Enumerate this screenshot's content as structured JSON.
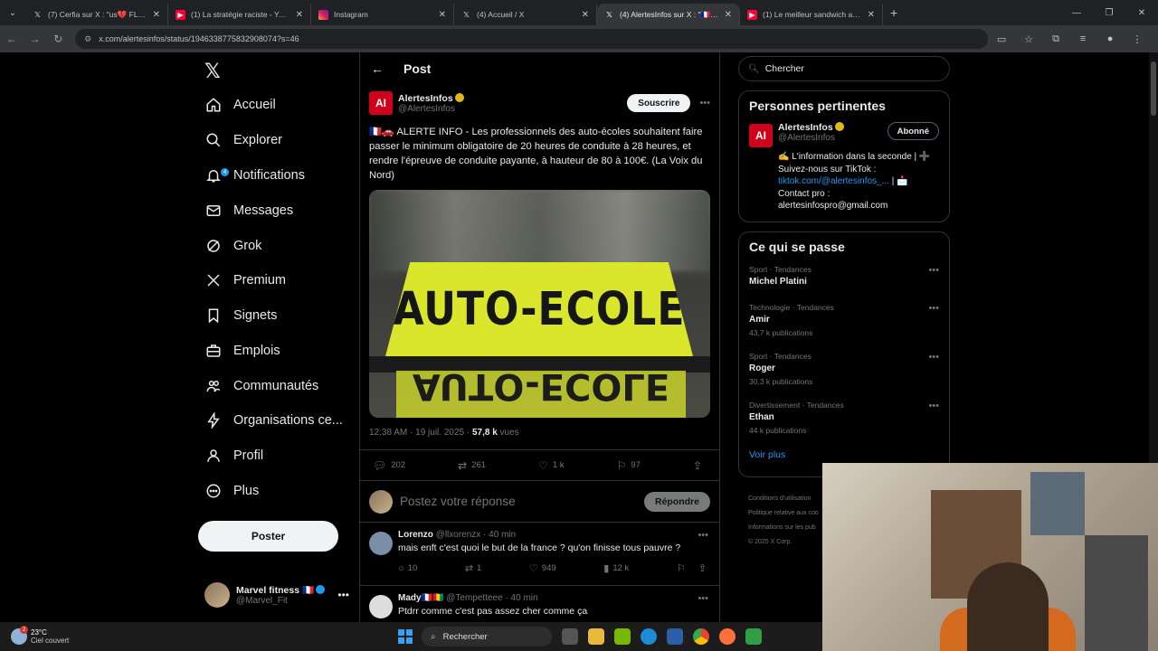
{
  "browser": {
    "tabs": [
      {
        "label": "(7) Cerfia sur X : \"us💔 FLASH |",
        "icon": "x-icon",
        "active": false
      },
      {
        "label": "(1) La stratégie raciste - YouTube",
        "icon": "youtube-icon",
        "active": false
      },
      {
        "label": "Instagram",
        "icon": "instagram-icon",
        "active": false
      },
      {
        "label": "(4) Accueil / X",
        "icon": "x-icon",
        "active": false
      },
      {
        "label": "(4) AlertesInfos sur X : \"🇫🇷🚗 AL",
        "icon": "x-icon",
        "active": true
      },
      {
        "label": "(1) Le meilleur sandwich au mo",
        "icon": "youtube-icon",
        "active": false
      }
    ],
    "url": "x.com/alertesinfos/status/1946338775832908074?s=46"
  },
  "sidebar": {
    "items": [
      {
        "label": "Accueil",
        "icon": "home-icon"
      },
      {
        "label": "Explorer",
        "icon": "search-icon"
      },
      {
        "label": "Notifications",
        "icon": "bell-icon",
        "badge": "4"
      },
      {
        "label": "Messages",
        "icon": "mail-icon"
      },
      {
        "label": "Grok",
        "icon": "grok-icon"
      },
      {
        "label": "Premium",
        "icon": "x-icon"
      },
      {
        "label": "Signets",
        "icon": "bookmark-icon"
      },
      {
        "label": "Emplois",
        "icon": "briefcase-icon"
      },
      {
        "label": "Communautés",
        "icon": "people-icon"
      },
      {
        "label": "Organisations ce...",
        "icon": "lightning-icon"
      },
      {
        "label": "Profil",
        "icon": "person-icon"
      },
      {
        "label": "Plus",
        "icon": "more-circle-icon"
      }
    ],
    "post_button": "Poster",
    "account": {
      "name": "Marvel fitness 🇫🇷",
      "handle": "@Marvel_Fit"
    }
  },
  "main": {
    "header_title": "Post",
    "post": {
      "author_name": "AlertesInfos",
      "author_handle": "@AlertesInfos",
      "subscribe_label": "Souscrire",
      "text": "🇫🇷🚗 ALERTE INFO - Les professionnels des auto-écoles souhaitent faire passer le minimum obligatoire de 20 heures de conduite à 28 heures, et rendre l'épreuve de conduite payante, à hauteur de 80 à 100€. (La Voix du Nord)",
      "image_sign_text": "AUTO-ECOLE",
      "image_reflect_text": "AUTO-ECOLE",
      "timestamp": "12:38 AM · 19 juil. 2025 · ",
      "views": "57,8 k",
      "views_suffix": " vues",
      "replies": "202",
      "reposts": "261",
      "likes": "1 k",
      "bookmarks": "97"
    },
    "reply_placeholder": "Postez votre réponse",
    "reply_button": "Répondre",
    "comments": [
      {
        "name": "Lorenzo",
        "handle": "@llxorenzx",
        "time": " · 40 min",
        "text": "mais enft c'est quoi le but de la france ? qu'on finisse tous pauvre ?",
        "replies": "10",
        "reposts": "1",
        "likes": "949",
        "views": "12 k"
      },
      {
        "name": "Mady🇫🇷🇬🇳",
        "handle": "@Tempetteee",
        "time": " · 40 min",
        "text": "Ptdrr comme c'est pas assez cher comme ça",
        "replies": "",
        "reposts": "",
        "likes": "",
        "views": ""
      }
    ]
  },
  "right": {
    "search_placeholder": "Chercher",
    "relevant_title": "Personnes pertinentes",
    "relevant": {
      "name": "AlertesInfos",
      "handle": "@AlertesInfos",
      "follow_label": "Abonné",
      "bio_line1": "✍️ L'information dans la seconde | ➕",
      "bio_line2": "Suivez-nous sur TikTok :",
      "bio_link": "tiktok.com/@alertesinfos_...",
      "bio_after_link": " | 📩",
      "bio_line3": "Contact pro :",
      "bio_line4": "alertesinfospro@gmail.com"
    },
    "trends_title": "Ce qui se passe",
    "trends": [
      {
        "category": "Sport · Tendances",
        "name": "Michel Platini",
        "count": ""
      },
      {
        "category": "Technologie · Tendances",
        "name": "Amir",
        "count": "43,7 k publications"
      },
      {
        "category": "Sport · Tendances",
        "name": "Roger",
        "count": "30,3 k publications"
      },
      {
        "category": "Divertissement · Tendances",
        "name": "Ethan",
        "count": "44 k publications"
      }
    ],
    "see_more": "Voir plus",
    "footer": [
      "Conditions d'utilisation",
      "Politique relative aux coo",
      "Informations sur les pub",
      "© 2025 X Corp."
    ]
  },
  "taskbar": {
    "temperature": "23°C",
    "weather": "Ciel couvert",
    "search": "Rechercher"
  },
  "colors": {
    "accent": "#1d9bf0",
    "verified_gold": "#e2b719",
    "brand_red": "#d0021b"
  }
}
